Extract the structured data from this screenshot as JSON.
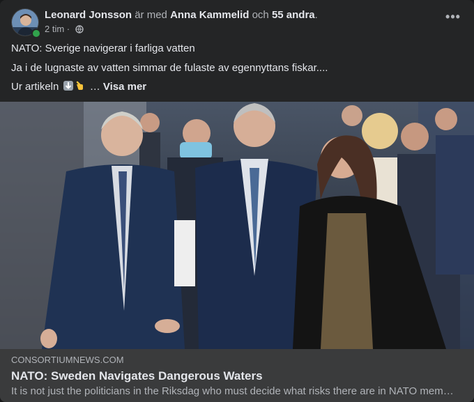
{
  "post": {
    "author": "Leonard Jonsson",
    "with_text": "är med",
    "tagged": "Anna Kammelid",
    "and_text": "och",
    "others": "55 andra",
    "period": ".",
    "time": "2 tim",
    "separator": "·",
    "privacy_icon": "globe-icon",
    "more_icon": "more-options-icon",
    "more_label": "•••",
    "line1": "NATO: Sverige navigerar i farliga vatten",
    "line2": "Ja i de lugnaste av vatten simmar de fulaste av egennyttans fiskar....",
    "line3_prefix": "Ur artikeln",
    "line3_ellipsis": "…",
    "see_more": "Visa mer"
  },
  "link": {
    "domain": "CONSORTIUMNEWS.COM",
    "title": "NATO: Sweden Navigates Dangerous Waters",
    "description": "It is not just the politicians in the Riksdag who must decide what risks there are in NATO membership"
  },
  "colors": {
    "card_bg": "#242526",
    "link_bg": "#3a3b3c",
    "online": "#31a24c"
  }
}
